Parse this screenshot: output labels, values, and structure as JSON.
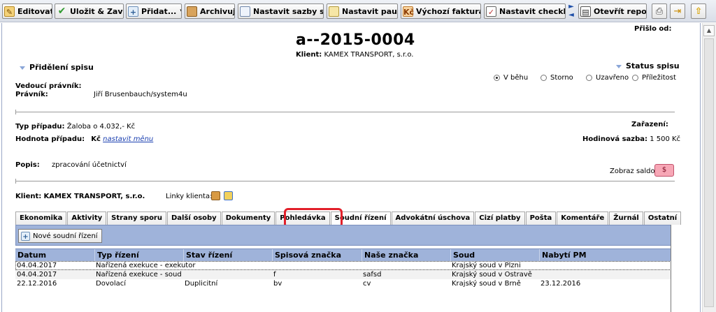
{
  "toolbar": {
    "buttons": [
      {
        "label": "Editovat",
        "icon": "edit-icon"
      },
      {
        "label": "Uložit & Zavřít",
        "icon": "checkmark-icon"
      },
      {
        "label": "Přidat...",
        "icon": "add-icon",
        "dropdown": "▼"
      },
      {
        "label": "Archivuj",
        "icon": "archive-icon"
      },
      {
        "label": "Nastavit sazby spisu",
        "icon": "rates-icon"
      },
      {
        "label": "Nastavit paušál",
        "icon": "flat-fee-icon"
      },
      {
        "label": "Výchozí fakturace",
        "icon": "billing-icon"
      },
      {
        "label": "Nastavit checklist",
        "icon": "checklist-icon"
      },
      {
        "label": "Otevřít report",
        "icon": "report-icon"
      }
    ]
  },
  "header": {
    "case_number": "a--2015-0004",
    "client_label": "Klient:",
    "client_name": "KAMEX TRANSPORT, s.r.o.",
    "arrived_label": "Přišlo od:"
  },
  "assignment": {
    "section_title": "Přidělení spisu",
    "lead_lawyer_label": "Vedoucí právník:",
    "lawyer_label": "Právník:",
    "lawyer_value": "Jiří Brusenbauch/system4u"
  },
  "status": {
    "section_title": "Status spisu",
    "options": [
      {
        "label": "V běhu",
        "selected": true
      },
      {
        "label": "Storno",
        "selected": false
      },
      {
        "label": "Uzavřeno",
        "selected": false
      },
      {
        "label": "Příležitost",
        "selected": false
      }
    ]
  },
  "case_info": {
    "type_label": "Typ případu:",
    "type_value": "Žaloba o 4.032,- Kč",
    "value_label": "Hodnota případu:",
    "currency": "Kč",
    "currency_link": "nastavit měnu",
    "category_label": "Zařazení:",
    "hourly_rate_label": "Hodinová sazba:",
    "hourly_rate_value": "1 500 Kč",
    "description_label": "Popis:",
    "description_value": "zpracování účetnictví",
    "balance_label": "Zobraz saldo:",
    "balance_button": "$"
  },
  "client_links": {
    "client_label": "Klient:",
    "client_name": "KAMEX TRANSPORT, s.r.o.",
    "links_label": "Linky klienta:"
  },
  "tabs": [
    {
      "label": "Ekonomika",
      "active": false
    },
    {
      "label": "Aktivity",
      "active": false
    },
    {
      "label": "Strany sporu",
      "active": false
    },
    {
      "label": "Další osoby",
      "active": false
    },
    {
      "label": "Dokumenty",
      "active": false
    },
    {
      "label": "Pohledávka",
      "active": false
    },
    {
      "label": "Soudní řízení",
      "active": true
    },
    {
      "label": "Advokátní úschova",
      "active": false
    },
    {
      "label": "Cizí platby",
      "active": false
    },
    {
      "label": "Pošta",
      "active": false
    },
    {
      "label": "Komentáře",
      "active": false
    },
    {
      "label": "Žurnál",
      "active": false
    },
    {
      "label": "Ostatní",
      "active": false
    }
  ],
  "grid": {
    "new_button": "Nové soudní řízení",
    "columns": [
      "Datum",
      "Typ řízení",
      "Stav řízení",
      "Spisová značka",
      "Naše značka",
      "Soud",
      "Nabytí PM"
    ],
    "rows": [
      [
        "04.04.2017",
        "Nařízená exekuce - exekutor",
        "",
        "",
        "",
        "Krajský soud v Plzni",
        ""
      ],
      [
        "04.04.2017",
        "Nařízená exekuce - soud",
        "",
        "f",
        "safsd",
        "Krajský soud v Ostravě",
        ""
      ],
      [
        "22.12.2016",
        "Dovolací",
        "Duplicitní",
        "bv",
        "cv",
        "Krajský soud v Brně",
        "23.12.2016"
      ]
    ]
  },
  "colors": {
    "grid_header_bg": "#9fb3da",
    "highlight_outline": "#e2202a",
    "balance_button_bg": "#f7a7b6"
  }
}
